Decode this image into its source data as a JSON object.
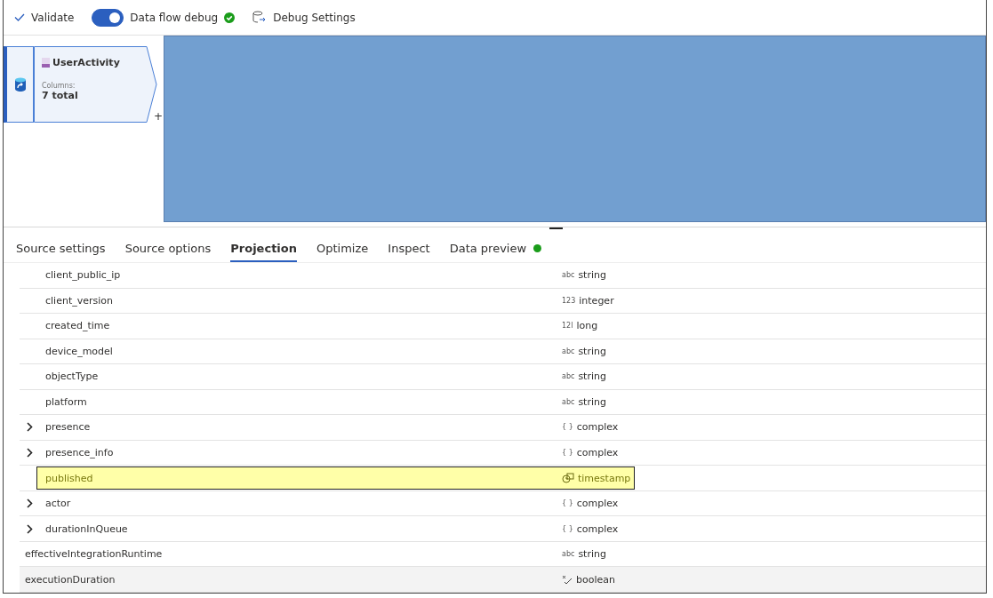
{
  "toolbar": {
    "validate": "Validate",
    "debug_toggle": {
      "on": true,
      "label": "Data flow debug",
      "ready": true
    },
    "debug_settings": "Debug Settings"
  },
  "canvas": {
    "node": {
      "title": "UserActivity",
      "columns_label": "Columns:",
      "columns_value": "7 total",
      "selected": true,
      "add": "+"
    },
    "redacted": true
  },
  "tabs": [
    {
      "label": "Source settings",
      "selected": false,
      "indicator": false
    },
    {
      "label": "Source options",
      "selected": false,
      "indicator": false
    },
    {
      "label": "Projection",
      "selected": true,
      "indicator": false
    },
    {
      "label": "Optimize",
      "selected": false,
      "indicator": false
    },
    {
      "label": "Inspect",
      "selected": false,
      "indicator": false
    },
    {
      "label": "Data preview",
      "selected": false,
      "indicator": true
    }
  ],
  "projection": {
    "nested_fields": [
      {
        "name": "client_public_ip",
        "type": "string",
        "badge": "abc",
        "kind": "text",
        "expandable": false,
        "highlighted": false
      },
      {
        "name": "client_version",
        "type": "integer",
        "badge": "123",
        "kind": "text",
        "expandable": false,
        "highlighted": false
      },
      {
        "name": "created_time",
        "type": "long",
        "badge": "12l",
        "kind": "text",
        "expandable": false,
        "highlighted": false
      },
      {
        "name": "device_model",
        "type": "string",
        "badge": "abc",
        "kind": "text",
        "expandable": false,
        "highlighted": false
      },
      {
        "name": "objectType",
        "type": "string",
        "badge": "abc",
        "kind": "text",
        "expandable": false,
        "highlighted": false
      },
      {
        "name": "platform",
        "type": "string",
        "badge": "abc",
        "kind": "text",
        "expandable": false,
        "highlighted": false
      },
      {
        "name": "presence",
        "type": "complex",
        "badge": "{ }",
        "kind": "text",
        "expandable": true,
        "highlighted": false
      },
      {
        "name": "presence_info",
        "type": "complex",
        "badge": "{ }",
        "kind": "text",
        "expandable": true,
        "highlighted": false
      },
      {
        "name": "published",
        "type": "timestamp",
        "kind": "timestamp",
        "expandable": false,
        "highlighted": true
      },
      {
        "name": "actor",
        "type": "complex",
        "badge": "{ }",
        "kind": "text",
        "expandable": true,
        "highlighted": false
      },
      {
        "name": "durationInQueue",
        "type": "complex",
        "badge": "{ }",
        "kind": "text",
        "expandable": true,
        "highlighted": false
      }
    ],
    "fields": [
      {
        "name": "effectiveIntegrationRuntime",
        "type": "string",
        "badge": "abc",
        "kind": "text",
        "hovered": false
      },
      {
        "name": "executionDuration",
        "type": "boolean",
        "kind": "boolean",
        "hovered": true
      }
    ]
  }
}
